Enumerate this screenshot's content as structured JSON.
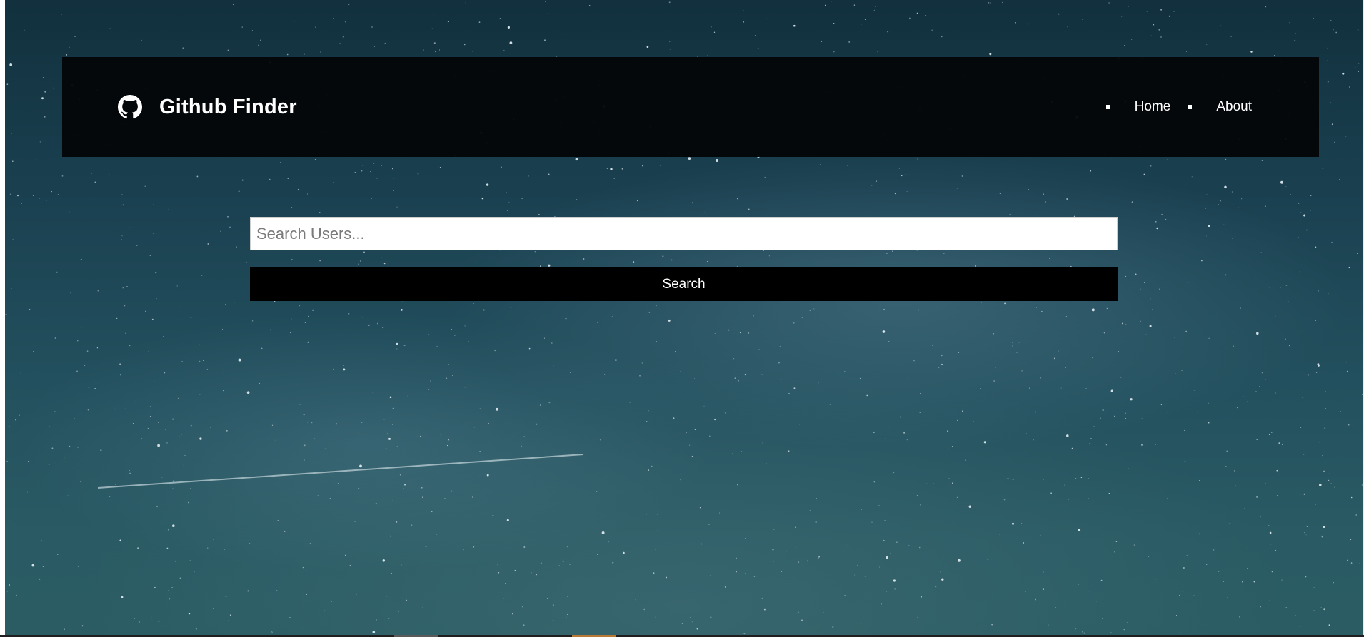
{
  "app": {
    "title": "Github Finder",
    "icon": "github-icon"
  },
  "nav": {
    "items": [
      {
        "label": "Home"
      },
      {
        "label": "About"
      }
    ]
  },
  "search": {
    "placeholder": "Search Users...",
    "value": "",
    "button_label": "Search"
  },
  "colors": {
    "navbar_bg": "#040608",
    "button_bg": "#000000",
    "text": "#ffffff"
  }
}
